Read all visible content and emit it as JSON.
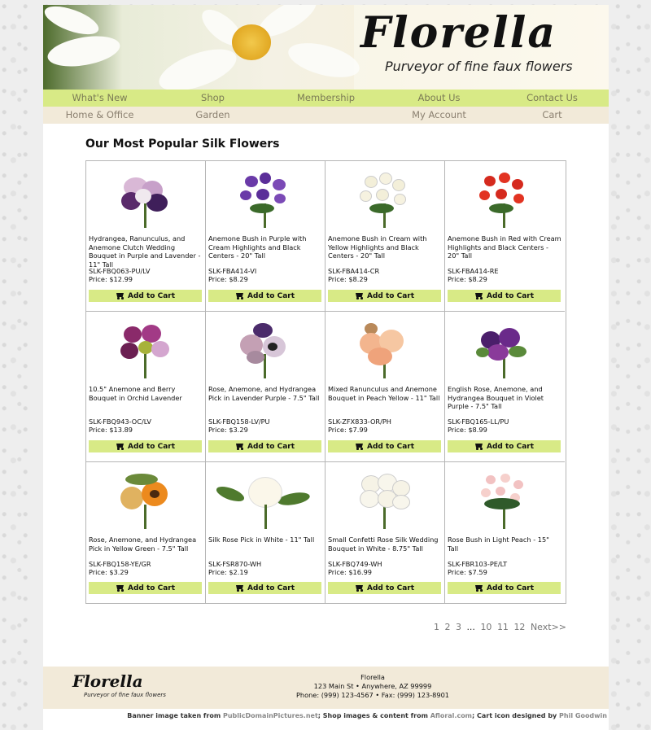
{
  "brand": {
    "name": "Florella",
    "tagline": "Purveyor of fine faux flowers"
  },
  "nav_primary": [
    "What's New",
    "Shop",
    "Membership",
    "About Us",
    "Contact Us"
  ],
  "nav_secondary": [
    "Home & Office",
    "Garden",
    "",
    "My Account",
    "Cart"
  ],
  "heading": "Our Most Popular Silk Flowers",
  "cart_label": "Add to Cart",
  "products": [
    {
      "name": "Hydrangea, Ranunculus, and Anemone Clutch Wedding Bouquet in Purple and Lavender - 11\" Tall",
      "sku": "SLK-FBQ063-PU/LV",
      "price": "Price: $12.99"
    },
    {
      "name": "Anemone Bush in Purple with Cream Highlights and Black Centers - 20\" Tall",
      "sku": "SLK-FBA414-VI",
      "price": "Price: $8.29"
    },
    {
      "name": "Anemone Bush in Cream with Yellow Highlights and Black Centers - 20\" Tall",
      "sku": "SLK-FBA414-CR",
      "price": "Price: $8.29"
    },
    {
      "name": "Anemone Bush in Red with Cream Highlights and Black Centers - 20\" Tall",
      "sku": "SLK-FBA414-RE",
      "price": "Price: $8.29"
    },
    {
      "name": "10.5\" Anemone and Berry Bouquet in Orchid Lavender",
      "sku": "SLK-FBQ943-OC/LV",
      "price": "Price: $13.89"
    },
    {
      "name": "Rose, Anemone, and Hydrangea Pick in Lavender Purple - 7.5\" Tall",
      "sku": "SLK-FBQ158-LV/PU",
      "price": "Price: $3.29"
    },
    {
      "name": "Mixed Ranunculus and Anemone Bouquet in Peach Yellow - 11\" Tall",
      "sku": "SLK-ZFX833-OR/PH",
      "price": "Price: $7.99"
    },
    {
      "name": "English Rose, Anemone, and Hydrangea Bouquet in Violet Purple - 7.5\" Tall",
      "sku": "SLK-FBQ165-LL/PU",
      "price": "Price: $8.99"
    },
    {
      "name": "Rose, Anemone, and Hydrangea Pick in Yellow Green - 7.5\" Tall",
      "sku": "SLK-FBQ158-YE/GR",
      "price": "Price: $3.29"
    },
    {
      "name": "Silk Rose Pick in White - 11\" Tall",
      "sku": "SLK-FSR870-WH",
      "price": "Price: $2.19"
    },
    {
      "name": "Small Confetti Rose Silk Wedding Bouquet in White - 8.75\" Tall",
      "sku": "SLK-FBQ749-WH",
      "price": "Price: $16.99"
    },
    {
      "name": "Rose Bush in Light Peach - 15\" Tall",
      "sku": "SLK-FBR103-PE/LT",
      "price": "Price: $7.59"
    }
  ],
  "pager": {
    "pages": [
      "1",
      "2",
      "3",
      "...",
      "10",
      "11",
      "12"
    ],
    "next": "Next>>"
  },
  "footer": {
    "company": "Florella",
    "address": "123 Main St • Anywhere, AZ 99999",
    "contact": "Phone: (999) 123-4567 • Fax: (999) 123-8901",
    "credits_prefix": "Banner image taken from ",
    "credits_src1": "PublicDomainPictures.net",
    "credits_mid": "; Shop images & content from ",
    "credits_src2": "Afloral.com",
    "credits_mid2": "; Cart icon designed by ",
    "credits_src3": "Phil Goodwin"
  }
}
